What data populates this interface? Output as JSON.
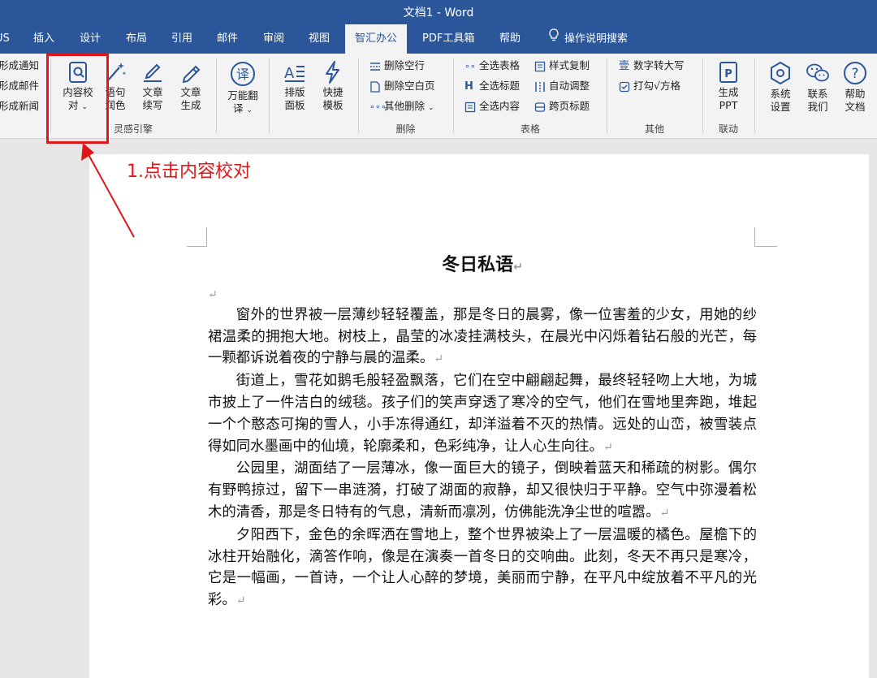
{
  "window": {
    "title": "文档1  -  Word"
  },
  "tabs": [
    {
      "label": "US"
    },
    {
      "label": "插入"
    },
    {
      "label": "设计"
    },
    {
      "label": "布局"
    },
    {
      "label": "引用"
    },
    {
      "label": "邮件"
    },
    {
      "label": "审阅"
    },
    {
      "label": "视图"
    },
    {
      "label": "智汇办公",
      "active": true
    },
    {
      "label": "PDF工具箱"
    },
    {
      "label": "帮助"
    },
    {
      "label": "操作说明搜索"
    }
  ],
  "ribbon": {
    "left_items": [
      "形成通知",
      "形成邮件",
      "形成新闻"
    ],
    "inspiration": {
      "proofread": [
        "内容校",
        "对"
      ],
      "polish": [
        "语句",
        "润色"
      ],
      "continue": [
        "文章",
        "续写"
      ],
      "generate": [
        "文章",
        "生成"
      ],
      "group": "灵感引擎"
    },
    "translate": [
      "万能翻",
      "译"
    ],
    "layout": [
      "排版",
      "面板"
    ],
    "template": [
      "快捷",
      "模板"
    ],
    "delete": {
      "items": [
        "删除空行",
        "删除空白页",
        "其他删除"
      ],
      "group": "删除"
    },
    "table": {
      "col1": [
        "全选表格",
        "全选标题",
        "全选内容"
      ],
      "col2": [
        "样式复制",
        "自动调整",
        "跨页标题"
      ],
      "group": "表格"
    },
    "other": {
      "items": [
        "数字转大写",
        "打勾√方格"
      ],
      "group": "其他"
    },
    "ppt": {
      "label": [
        "生成",
        "PPT"
      ],
      "group": "联动"
    },
    "settings": [
      "系统",
      "设置"
    ],
    "contact": [
      "联系",
      "我们"
    ],
    "help": [
      "帮助",
      "文档"
    ]
  },
  "annotation": "1.点击内容校对",
  "document": {
    "title": "冬日私语",
    "paragraphs": [
      "窗外的世界被一层薄纱轻轻覆盖，那是冬日的晨雾，像一位害羞的少女，用她的纱裙温柔的拥抱大地。树枝上，晶莹的冰凌挂满枝头，在晨光中闪烁着钻石般的光芒，每一颗都诉说着夜的宁静与晨的温柔。",
      "街道上，雪花如鹅毛般轻盈飘落，它们在空中翩翩起舞，最终轻轻吻上大地，为城市披上了一件洁白的绒毯。孩子们的笑声穿透了寒冷的空气，他们在雪地里奔跑，堆起一个个憨态可掬的雪人，小手冻得通红，却洋溢着不灭的热情。远处的山峦，被雪装点得如同水墨画中的仙境，轮廓柔和，色彩纯净，让人心生向往。",
      "公园里，湖面结了一层薄冰，像一面巨大的镜子，倒映着蓝天和稀疏的树影。偶尔有野鸭掠过，留下一串涟漪，打破了湖面的寂静，却又很快归于平静。空气中弥漫着松木的清香，那是冬日特有的气息，清新而凛冽，仿佛能洗净尘世的喧嚣。",
      "夕阳西下，金色的余晖洒在雪地上，整个世界被染上了一层温暖的橘色。屋檐下的冰柱开始融化，滴答作响，像是在演奏一首冬日的交响曲。此刻，冬天不再只是寒冷，它是一幅画，一首诗，一个让人心醉的梦境，美丽而宁静，在平凡中绽放着不平凡的光彩。"
    ],
    "paragraph_mark": "↵"
  },
  "colors": {
    "accent": "#2b579a",
    "highlight": "#e0161b"
  }
}
